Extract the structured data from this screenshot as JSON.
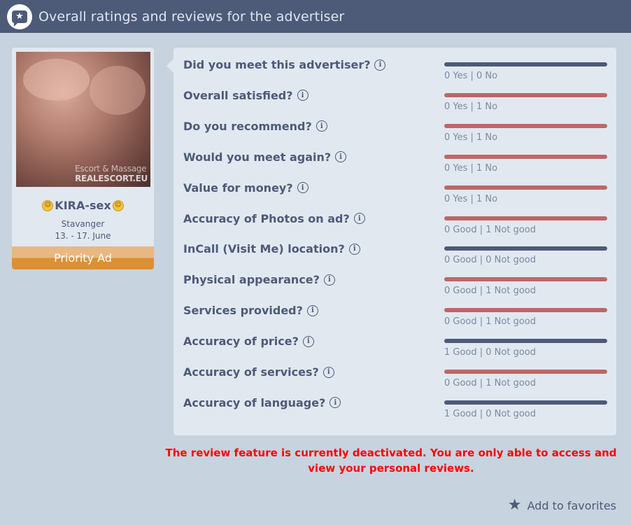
{
  "header": {
    "title": "Overall ratings and reviews for the advertiser",
    "icon": "star-chat-icon"
  },
  "profile": {
    "watermark": {
      "thin": "Escort & Massage",
      "bold": "REALESCORT.EU"
    },
    "name": "KIRA-sex",
    "city": "Stavanger",
    "dates": "13. - 17. June",
    "badge": "Priority Ad"
  },
  "ratings": [
    {
      "question": "Did you meet this advertiser?",
      "counts": "0 Yes | 0 No",
      "bar": "neutral"
    },
    {
      "question": "Overall satisfied?",
      "counts": "0 Yes | 1 No",
      "bar": "negative"
    },
    {
      "question": "Do you recommend?",
      "counts": "0 Yes | 1 No",
      "bar": "negative"
    },
    {
      "question": "Would you meet again?",
      "counts": "0 Yes | 1 No",
      "bar": "negative"
    },
    {
      "question": "Value for money?",
      "counts": "0 Yes | 1 No",
      "bar": "negative"
    },
    {
      "question": "Accuracy of Photos on ad?",
      "counts": "0 Good | 1 Not good",
      "bar": "negative"
    },
    {
      "question": "InCall (Visit Me) location?",
      "counts": "0 Good | 0 Not good",
      "bar": "neutral"
    },
    {
      "question": "Physical appearance?",
      "counts": "0 Good | 1 Not good",
      "bar": "negative"
    },
    {
      "question": "Services provided?",
      "counts": "0 Good | 1 Not good",
      "bar": "negative"
    },
    {
      "question": "Accuracy of price?",
      "counts": "1 Good | 0 Not good",
      "bar": "neutral"
    },
    {
      "question": "Accuracy of services?",
      "counts": "0 Good | 1 Not good",
      "bar": "negative"
    },
    {
      "question": "Accuracy of language?",
      "counts": "1 Good | 0 Not good",
      "bar": "neutral"
    }
  ],
  "notice": "The review feature is currently deactivated. You are only able to access and view your personal reviews.",
  "favorites": {
    "label": "Add to favorites"
  },
  "colors": {
    "header": "#4d5a78",
    "negative_bar": "#bd6766",
    "neutral_bar": "#4d5a78",
    "notice": "#ff0000",
    "priority": "#dc9034"
  }
}
